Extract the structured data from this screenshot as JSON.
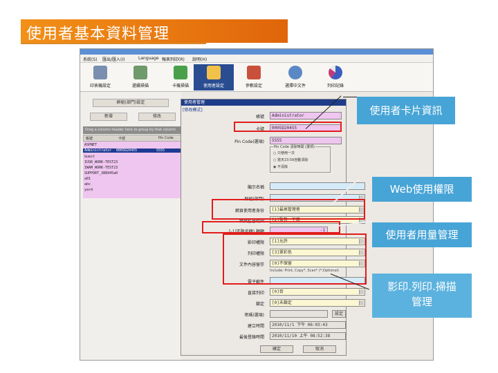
{
  "slide": {
    "title": "使用者基本資料管理"
  },
  "app": {
    "menu": [
      "系統(S)",
      "匯出/匯入(I)",
      "Language",
      "報表列印(R)",
      "說明(H)"
    ],
    "toolbar": [
      {
        "label": "印表機設定",
        "icon": "printer-icon"
      },
      {
        "label": "還續掃描",
        "icon": "scanner-icon"
      },
      {
        "label": "卡機掃描",
        "icon": "card-reader-icon"
      },
      {
        "label": "使用者設定",
        "icon": "user-settings-icon",
        "active": true
      },
      {
        "label": "參數設定",
        "icon": "settings-icon"
      },
      {
        "label": "選擇中文件",
        "icon": "document-icon"
      },
      {
        "label": "列印記錄",
        "icon": "pie-chart-icon"
      }
    ],
    "left_panel": {
      "group_button": "群組(部門)設定",
      "add_button": "新增",
      "edit_button": "修改",
      "group_hint": "Drag a column header here to group by that column",
      "columns": [
        "帳號",
        "卡號",
        "Pin Code"
      ],
      "rows": [
        {
          "account": "ASPNET",
          "card": "",
          "pin": ""
        },
        {
          "account": "Administrator",
          "card": "0005D20455",
          "pin": "5555",
          "selected": true
        },
        {
          "account": "Guest",
          "card": "",
          "pin": ""
        },
        {
          "account": "IUSR_WORK-TEST23",
          "card": "",
          "pin": ""
        },
        {
          "account": "IWAM_WORK-TEST23",
          "card": "",
          "pin": ""
        },
        {
          "account": "SUPPORT_388945a0",
          "card": "",
          "pin": ""
        },
        {
          "account": "a01",
          "card": "",
          "pin": ""
        },
        {
          "account": "abc",
          "card": "",
          "pin": ""
        },
        {
          "account": "yard",
          "card": "",
          "pin": ""
        }
      ]
    },
    "dialog": {
      "title": "使用者管理",
      "mode": "[修改模式]",
      "fields": {
        "account_label": "帳號",
        "account_value": "Administrator",
        "card_label": "卡號",
        "card_value": "0005D20455",
        "pin_label": "Pin Code(選項)",
        "pin_value": "5555",
        "clear_title": "Pin Code 清除時間 (選項)",
        "clear_options": [
          "只使用一次",
          "當天23:59自動清除",
          "不清除"
        ],
        "display_name_label": "顯示名稱",
        "group_label": "群組(部門)",
        "web_role_label": "網頁使用者身份",
        "web_role_value": "[1]最高管理者",
        "web_scope_label": "網頁監督範圍",
        "web_scope_value": "[2]監督一下層",
        "quota_label": "[-1]不限金額) 額額",
        "quota_value": "-1",
        "copy_label": "影印權限",
        "copy_value": "[1]允許",
        "print_label": "列印權限",
        "print_value": "[3]單彩色",
        "file_label": "文件內容留存",
        "file_value": "[0]不保留",
        "file_hint": "Include: Print, Copy*, Scan*  (*:Optional)",
        "email_label": "電子郵件",
        "direct_print_label": "直接列印",
        "direct_print_value": "[0]否",
        "lock_label": "鎖定",
        "lock_value": "[0]未鎖定",
        "password_label": "密碼(選項)",
        "password_button": "設定",
        "created_label": "建立時間",
        "created_value": "2010/11/1 下午 06:03:43",
        "last_login_label": "最後登錄時間",
        "last_login_value": "2010/11/10 上午 08:52:38"
      },
      "ok_button": "確定",
      "cancel_button": "取消"
    }
  },
  "callouts": {
    "card_info": "使用者卡片資訊",
    "web_permission": "Web使用權限",
    "quota": "使用者用量管理",
    "permissions": "影印.列印.掃描\n管理"
  },
  "colors": {
    "title_bar": "#e0650a",
    "callout": "#47a4d6",
    "highlight": "#e21b1b",
    "field_pink": "#efc6f0"
  }
}
